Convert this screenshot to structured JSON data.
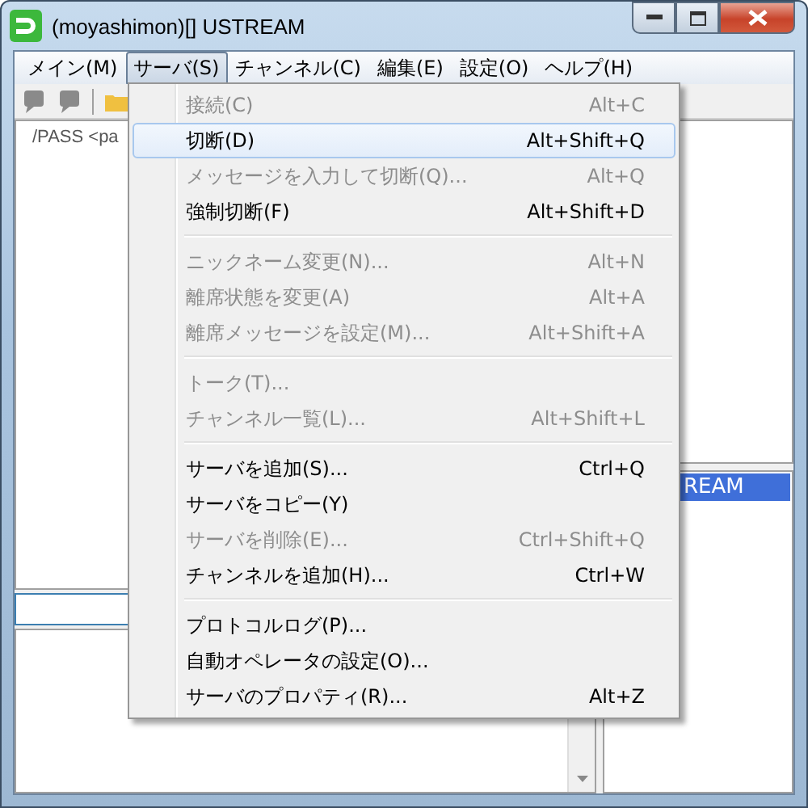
{
  "window": {
    "title": "(moyashimon)[] USTREAM"
  },
  "menubar": [
    {
      "label": "メイン(M)",
      "selected": false
    },
    {
      "label": "サーバ(S)",
      "selected": true
    },
    {
      "label": "チャンネル(C)",
      "selected": false
    },
    {
      "label": "編集(E)",
      "selected": false
    },
    {
      "label": "設定(O)",
      "selected": false
    },
    {
      "label": "ヘルプ(H)",
      "selected": false
    }
  ],
  "menu": {
    "items": [
      {
        "kind": "item",
        "label": "接続(C)",
        "shortcut": "Alt+C",
        "disabled": true,
        "selected": false
      },
      {
        "kind": "item",
        "label": "切断(D)",
        "shortcut": "Alt+Shift+Q",
        "disabled": false,
        "selected": true
      },
      {
        "kind": "item",
        "label": "メッセージを入力して切断(Q)...",
        "shortcut": "Alt+Q",
        "disabled": true,
        "selected": false
      },
      {
        "kind": "item",
        "label": "強制切断(F)",
        "shortcut": "Alt+Shift+D",
        "disabled": false,
        "selected": false
      },
      {
        "kind": "separator"
      },
      {
        "kind": "item",
        "label": "ニックネーム変更(N)...",
        "shortcut": "Alt+N",
        "disabled": true,
        "selected": false
      },
      {
        "kind": "item",
        "label": "離席状態を変更(A)",
        "shortcut": "Alt+A",
        "disabled": true,
        "selected": false
      },
      {
        "kind": "item",
        "label": "離席メッセージを設定(M)...",
        "shortcut": "Alt+Shift+A",
        "disabled": true,
        "selected": false
      },
      {
        "kind": "separator"
      },
      {
        "kind": "item",
        "label": "トーク(T)...",
        "disabled": true,
        "selected": false
      },
      {
        "kind": "item",
        "label": "チャンネル一覧(L)...",
        "shortcut": "Alt+Shift+L",
        "disabled": true,
        "selected": false
      },
      {
        "kind": "separator"
      },
      {
        "kind": "item",
        "label": "サーバを追加(S)...",
        "shortcut": "Ctrl+Q",
        "disabled": false,
        "selected": false
      },
      {
        "kind": "item",
        "label": "サーバをコピー(Y)",
        "disabled": false,
        "selected": false
      },
      {
        "kind": "item",
        "label": "サーバを削除(E)...",
        "shortcut": "Ctrl+Shift+Q",
        "disabled": true,
        "selected": false
      },
      {
        "kind": "item",
        "label": "チャンネルを追加(H)...",
        "shortcut": "Ctrl+W",
        "disabled": false,
        "selected": false
      },
      {
        "kind": "separator"
      },
      {
        "kind": "item",
        "label": "プロトコルログ(P)...",
        "disabled": false,
        "selected": false
      },
      {
        "kind": "item",
        "label": "自動オペレータの設定(O)...",
        "disabled": false,
        "selected": false
      },
      {
        "kind": "item",
        "label": "サーバのプロパティ(R)...",
        "shortcut": "Alt+Z",
        "disabled": false,
        "selected": false
      }
    ]
  },
  "log": {
    "lines": [
      "/PASS <pa"
    ]
  },
  "channel_list": {
    "items": [
      {
        "label": "REAM",
        "selected": true
      }
    ]
  }
}
